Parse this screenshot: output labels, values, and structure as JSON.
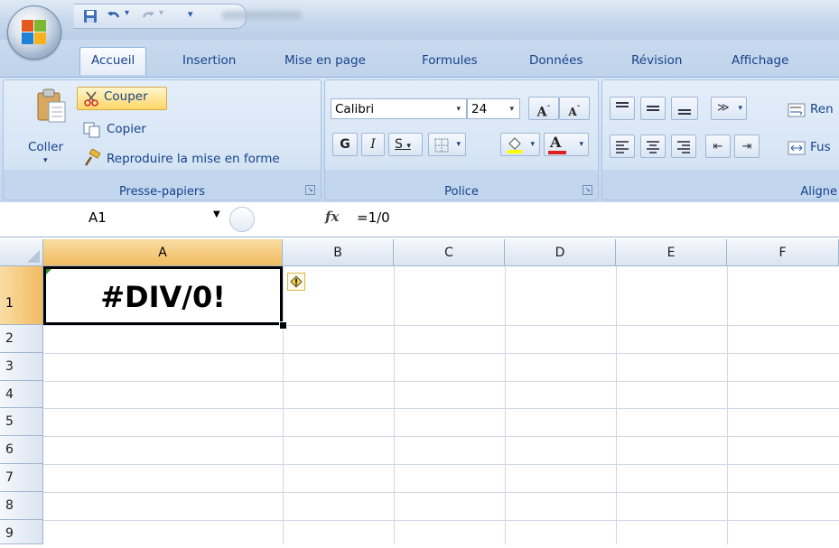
{
  "qat": {
    "separator_glyph": "▾"
  },
  "tabs": [
    {
      "label": "Accueil",
      "active": true
    },
    {
      "label": "Insertion"
    },
    {
      "label": "Mise en page"
    },
    {
      "label": "Formules"
    },
    {
      "label": "Données"
    },
    {
      "label": "Révision"
    },
    {
      "label": "Affichage"
    }
  ],
  "clipboard": {
    "paste_label": "Coller",
    "cut_label": "Couper",
    "copy_label": "Copier",
    "format_painter_label": "Reproduire la mise en forme",
    "group_label": "Presse-papiers"
  },
  "font": {
    "name": "Calibri",
    "size": "24",
    "bold": "G",
    "italic": "I",
    "underline": "S",
    "group_label": "Police"
  },
  "alignment": {
    "wrap_label": "Ren",
    "merge_label": "Fus",
    "group_label": "Aligne"
  },
  "formula_bar": {
    "name_box": "A1",
    "fx": "fx",
    "formula": "=1/0"
  },
  "sheet": {
    "columns": [
      "A",
      "B",
      "C",
      "D",
      "E",
      "F"
    ],
    "rows": [
      "1",
      "2",
      "3",
      "4",
      "5",
      "6",
      "7",
      "8",
      "9"
    ],
    "cell_a1": "#DIV/0!",
    "selected_cell": "A1"
  },
  "colors": {
    "accent": "#15428b",
    "selection_header": "#f2bb60",
    "ribbon": "#dce8f6"
  }
}
